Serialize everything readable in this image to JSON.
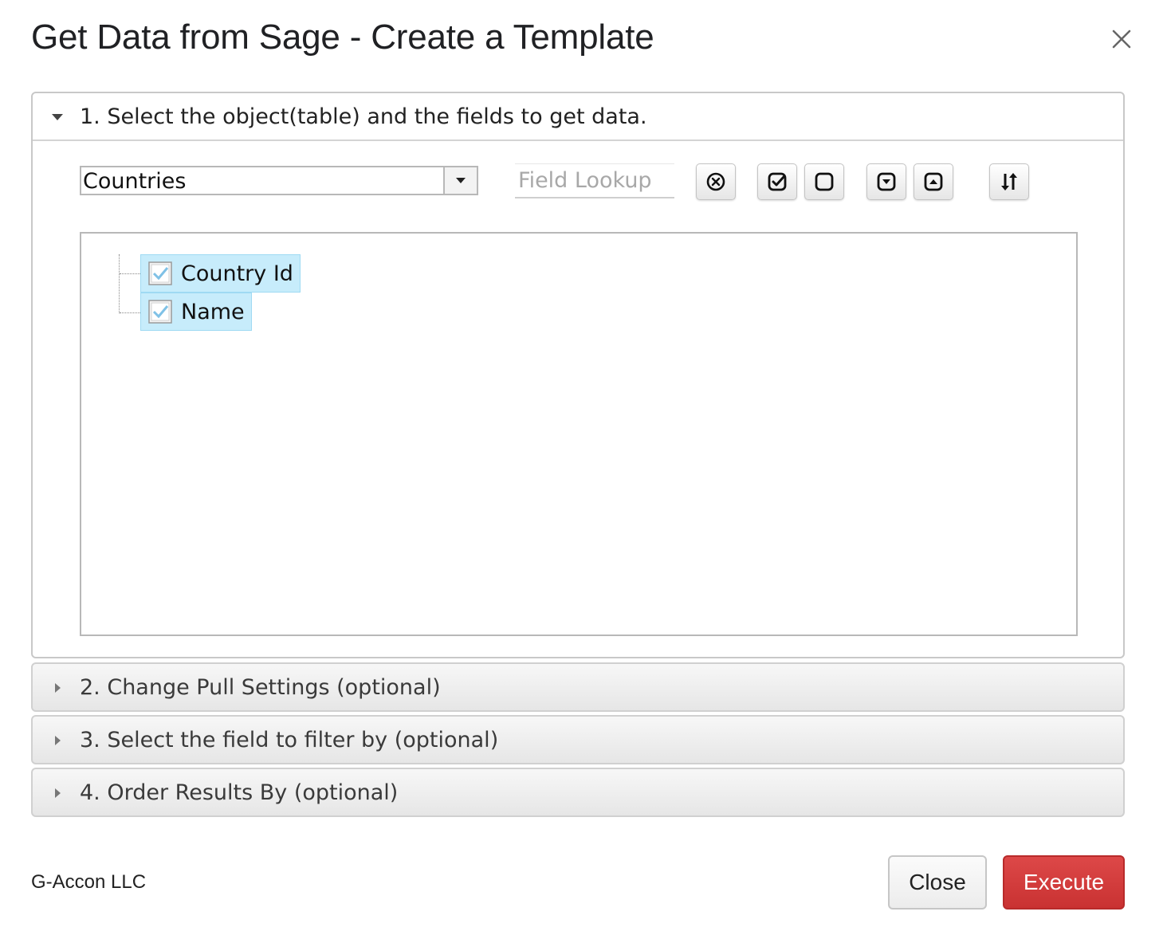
{
  "dialog": {
    "title": "Get Data from Sage - Create a Template"
  },
  "sections": [
    {
      "label": "1. Select the object(table) and the fields to get data.",
      "expanded": true
    },
    {
      "label": "2. Change Pull Settings (optional)",
      "expanded": false
    },
    {
      "label": "3. Select the field to filter by (optional)",
      "expanded": false
    },
    {
      "label": "4. Order Results By (optional)",
      "expanded": false
    }
  ],
  "object_select": {
    "value": "Countries"
  },
  "field_lookup": {
    "placeholder": "Field Lookup",
    "value": ""
  },
  "toolbar": {
    "icons": [
      "clear-icon",
      "check-all-icon",
      "uncheck-all-icon",
      "expand-all-icon",
      "collapse-all-icon",
      "sort-icon"
    ]
  },
  "fields": [
    {
      "label": "Country Id",
      "checked": true
    },
    {
      "label": "Name",
      "checked": true
    }
  ],
  "footer": {
    "brand": "G-Accon LLC",
    "close_label": "Close",
    "execute_label": "Execute"
  },
  "colors": {
    "execute": "#d03838",
    "selection": "#c7ecfb"
  }
}
